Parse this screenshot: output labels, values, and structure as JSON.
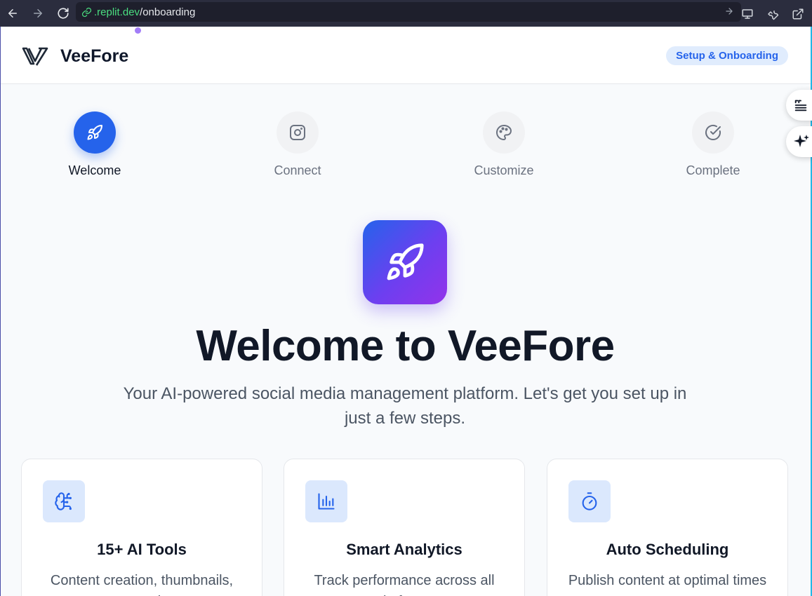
{
  "browser": {
    "url_host": ".replit.dev",
    "url_path": "/onboarding"
  },
  "header": {
    "brand": "VeeFore",
    "badge": "Setup & Onboarding"
  },
  "steps": [
    {
      "label": "Welcome",
      "icon": "rocket-icon",
      "active": true
    },
    {
      "label": "Connect",
      "icon": "instagram-icon",
      "active": false
    },
    {
      "label": "Customize",
      "icon": "palette-icon",
      "active": false
    },
    {
      "label": "Complete",
      "icon": "check-circle-icon",
      "active": false
    }
  ],
  "hero": {
    "title": "Welcome to VeeFore",
    "subtitle": "Your AI-powered social media management platform. Let's get you set up in just a few steps."
  },
  "features": [
    {
      "title": "15+ AI Tools",
      "desc": "Content creation, thumbnails, automation",
      "icon": "brain-icon"
    },
    {
      "title": "Smart Analytics",
      "desc": "Track performance across all platforms",
      "icon": "bar-chart-icon"
    },
    {
      "title": "Auto Scheduling",
      "desc": "Publish content at optimal times",
      "icon": "timer-icon"
    }
  ],
  "colors": {
    "accent": "#2563eb",
    "gradient_end": "#9333ea"
  }
}
